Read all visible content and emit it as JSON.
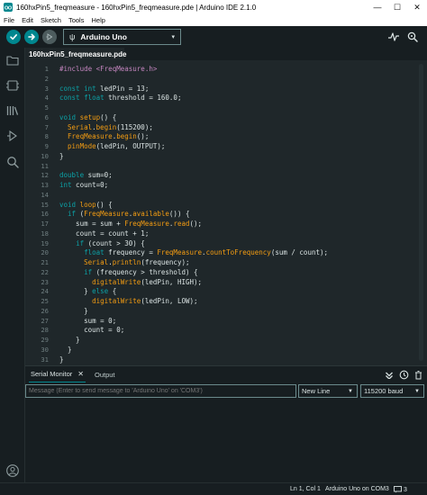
{
  "window": {
    "title": "160hxPin5_freqmeasure - 160hxPin5_freqmeasure.pde | Arduino IDE 2.1.0",
    "minimize": "—",
    "maximize": "☐",
    "close": "✕"
  },
  "menu": [
    "File",
    "Edit",
    "Sketch",
    "Tools",
    "Help"
  ],
  "toolbar": {
    "board": "Arduino Uno",
    "usb_glyph": "ψ",
    "chevron": "▾"
  },
  "tab": {
    "filename": "160hxPin5_freqmeasure.pde"
  },
  "editor": {
    "lines": [
      {
        "n": "1",
        "html": "<span class=\"pp\">#include &lt;FreqMeasure.h&gt;</span>"
      },
      {
        "n": "2",
        "html": ""
      },
      {
        "n": "3",
        "html": "<span class=\"kw\">const int</span> ledPin = 13;"
      },
      {
        "n": "4",
        "html": "<span class=\"kw\">const float</span> threshold = 160.0;"
      },
      {
        "n": "5",
        "html": ""
      },
      {
        "n": "6",
        "html": "<span class=\"kw\">void</span> <span class=\"fn\">setup</span>() {"
      },
      {
        "n": "7",
        "html": "  <span class=\"fn\">Serial</span>.<span class=\"fn\">begin</span>(115200);"
      },
      {
        "n": "8",
        "html": "  <span class=\"fn\">FreqMeasure</span>.<span class=\"fn\">begin</span>();"
      },
      {
        "n": "9",
        "html": "  <span class=\"fn\">pinMode</span>(ledPin, OUTPUT);"
      },
      {
        "n": "10",
        "html": "}"
      },
      {
        "n": "11",
        "html": ""
      },
      {
        "n": "12",
        "html": "<span class=\"kw\">double</span> sum=0;"
      },
      {
        "n": "13",
        "html": "<span class=\"kw\">int</span> count=0;"
      },
      {
        "n": "14",
        "html": ""
      },
      {
        "n": "15",
        "html": "<span class=\"kw\">void</span> <span class=\"fn\">loop</span>() {"
      },
      {
        "n": "16",
        "html": "  <span class=\"kw\">if</span> (<span class=\"fn\">FreqMeasure</span>.<span class=\"fn\">available</span>()) {"
      },
      {
        "n": "17",
        "html": "    sum = sum + <span class=\"fn\">FreqMeasure</span>.<span class=\"fn\">read</span>();"
      },
      {
        "n": "18",
        "html": "    count = count + 1;"
      },
      {
        "n": "19",
        "html": "    <span class=\"kw\">if</span> (count &gt; 30) {"
      },
      {
        "n": "20",
        "html": "      <span class=\"kw\">float</span> frequency = <span class=\"fn\">FreqMeasure</span>.<span class=\"fn\">countToFrequency</span>(sum / count);"
      },
      {
        "n": "21",
        "html": "      <span class=\"fn\">Serial</span>.<span class=\"fn\">println</span>(frequency);"
      },
      {
        "n": "22",
        "html": "      <span class=\"kw\">if</span> (frequency &gt; threshold) {"
      },
      {
        "n": "23",
        "html": "        <span class=\"fn\">digitalWrite</span>(ledPin, HIGH);"
      },
      {
        "n": "24",
        "html": "      } <span class=\"kw\">else</span> {"
      },
      {
        "n": "25",
        "html": "        <span class=\"fn\">digitalWrite</span>(ledPin, LOW);"
      },
      {
        "n": "26",
        "html": "      }"
      },
      {
        "n": "27",
        "html": "      sum = 0;"
      },
      {
        "n": "28",
        "html": "      count = 0;"
      },
      {
        "n": "29",
        "html": "    }"
      },
      {
        "n": "30",
        "html": "  }"
      },
      {
        "n": "31",
        "html": "}"
      }
    ]
  },
  "panel": {
    "serial_tab": "Serial Monitor",
    "output_tab": "Output",
    "close_glyph": "✕",
    "message_placeholder": "Message (Enter to send message to 'Arduino Uno' on 'COM3')",
    "line_ending": "New Line",
    "baud": "115200 baud",
    "caret": "▼"
  },
  "status": {
    "position": "Ln 1, Col 1",
    "board_port": "Arduino Uno on COM3",
    "count": "3"
  },
  "colors": {
    "accent": "#00878f",
    "background": "#171e21",
    "editor": "#1f272a"
  }
}
